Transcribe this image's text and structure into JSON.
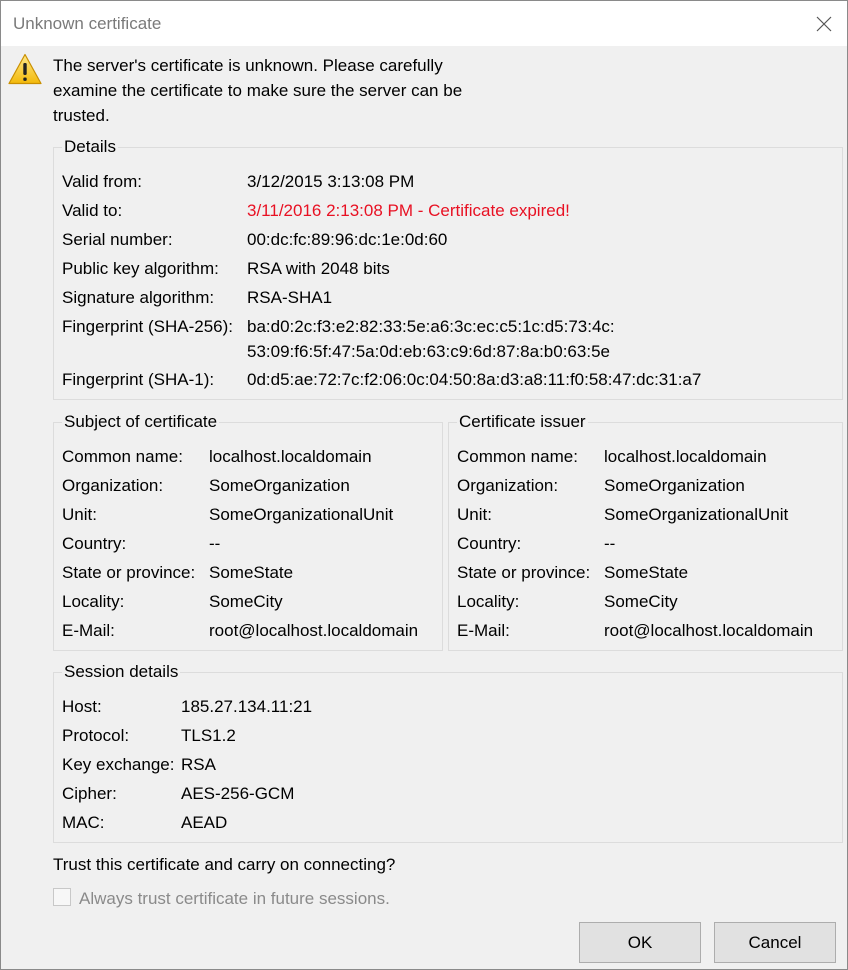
{
  "window": {
    "title": "Unknown certificate"
  },
  "message": "The server's certificate is unknown. Please carefully examine the certificate to make sure the server can be trusted.",
  "details": {
    "title": "Details",
    "rows": [
      {
        "label": "Valid from:",
        "value": "3/12/2015 3:13:08 PM"
      },
      {
        "label": "Valid to:",
        "value": "3/11/2016 2:13:08 PM - Certificate expired!"
      },
      {
        "label": "Serial number:",
        "value": "00:dc:fc:89:96:dc:1e:0d:60"
      },
      {
        "label": "Public key algorithm:",
        "value": "RSA with 2048 bits"
      },
      {
        "label": "Signature algorithm:",
        "value": "RSA-SHA1"
      },
      {
        "label": "Fingerprint (SHA-256):",
        "value": "ba:d0:2c:f3:e2:82:33:5e:a6:3c:ec:c5:1c:d5:73:4c:",
        "value2": "53:09:f6:5f:47:5a:0d:eb:63:c9:6d:87:8a:b0:63:5e"
      },
      {
        "label": "Fingerprint (SHA-1):",
        "value": "0d:d5:ae:72:7c:f2:06:0c:04:50:8a:d3:a8:11:f0:58:47:dc:31:a7"
      }
    ]
  },
  "subject": {
    "title": "Subject of certificate",
    "rows": [
      {
        "label": "Common name:",
        "value": "localhost.localdomain"
      },
      {
        "label": "Organization:",
        "value": "SomeOrganization"
      },
      {
        "label": "Unit:",
        "value": "SomeOrganizationalUnit"
      },
      {
        "label": "Country:",
        "value": "--"
      },
      {
        "label": "State or province:",
        "value": "SomeState"
      },
      {
        "label": "Locality:",
        "value": "SomeCity"
      },
      {
        "label": "E-Mail:",
        "value": "root@localhost.localdomain"
      }
    ]
  },
  "issuer": {
    "title": "Certificate issuer",
    "rows": [
      {
        "label": "Common name:",
        "value": "localhost.localdomain"
      },
      {
        "label": "Organization:",
        "value": "SomeOrganization"
      },
      {
        "label": "Unit:",
        "value": "SomeOrganizationalUnit"
      },
      {
        "label": "Country:",
        "value": "--"
      },
      {
        "label": "State or province:",
        "value": "SomeState"
      },
      {
        "label": "Locality:",
        "value": "SomeCity"
      },
      {
        "label": "E-Mail:",
        "value": "root@localhost.localdomain"
      }
    ]
  },
  "session": {
    "title": "Session details",
    "rows": [
      {
        "label": "Host:",
        "value": "185.27.134.11:21"
      },
      {
        "label": "Protocol:",
        "value": "TLS1.2"
      },
      {
        "label": "Key exchange:",
        "value": "RSA"
      },
      {
        "label": "Cipher:",
        "value": "AES-256-GCM"
      },
      {
        "label": "MAC:",
        "value": "AEAD"
      }
    ]
  },
  "question": "Trust this certificate and carry on connecting?",
  "checkbox": {
    "label": "Always trust certificate in future sessions.",
    "checked": false
  },
  "buttons": {
    "ok": "OK",
    "cancel": "Cancel"
  },
  "colors": {
    "expired": "#e81123",
    "disabled_text": "#8a8a8a"
  },
  "icons": {
    "warning": "warning-icon",
    "close": "close-icon"
  }
}
